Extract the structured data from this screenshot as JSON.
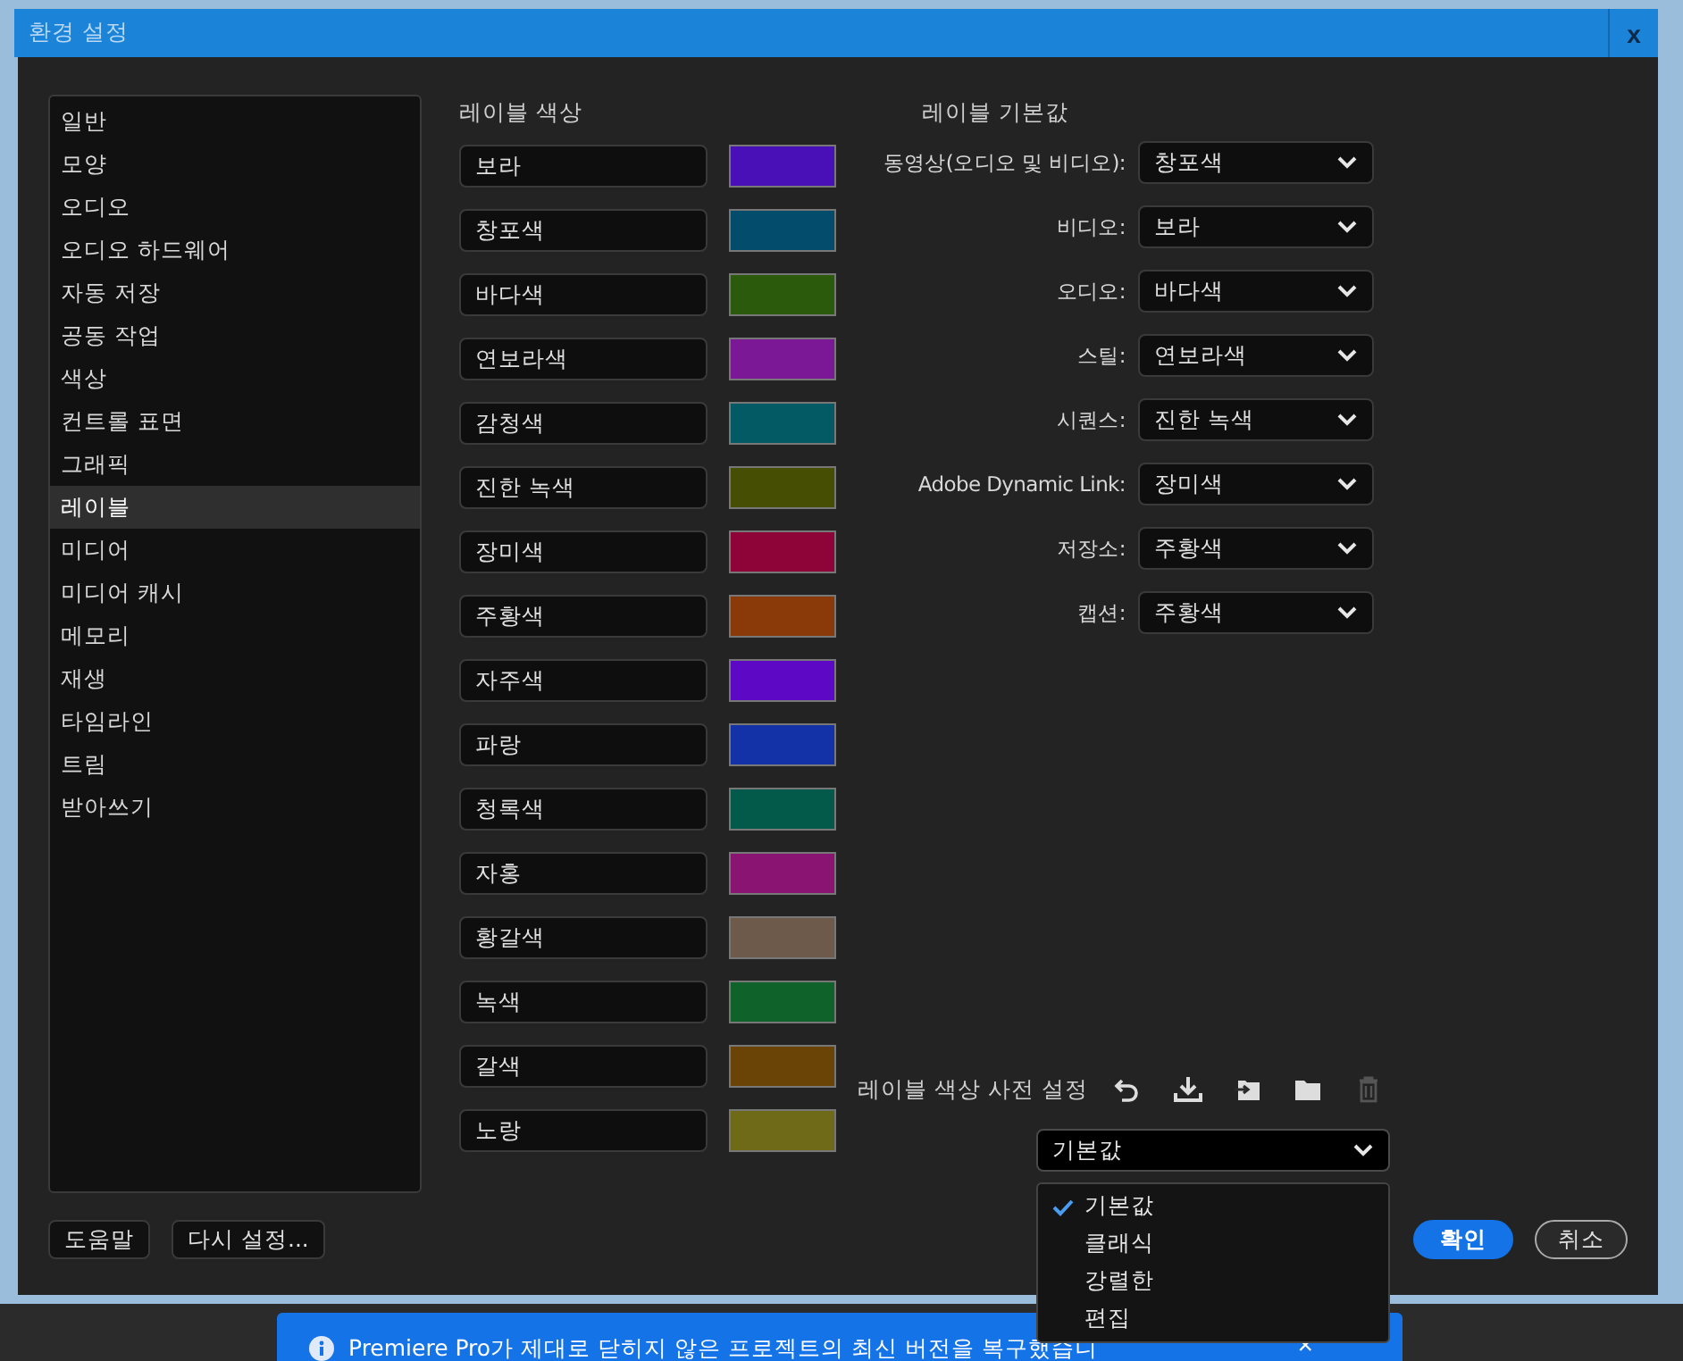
{
  "window": {
    "title": "환경 설정",
    "close": "x"
  },
  "sidebar": {
    "items": [
      {
        "label": "일반",
        "selected": false
      },
      {
        "label": "모양",
        "selected": false
      },
      {
        "label": "오디오",
        "selected": false
      },
      {
        "label": "오디오 하드웨어",
        "selected": false
      },
      {
        "label": "자동 저장",
        "selected": false
      },
      {
        "label": "공동 작업",
        "selected": false
      },
      {
        "label": "색상",
        "selected": false
      },
      {
        "label": "컨트롤 표면",
        "selected": false
      },
      {
        "label": "그래픽",
        "selected": false
      },
      {
        "label": "레이블",
        "selected": true
      },
      {
        "label": "미디어",
        "selected": false
      },
      {
        "label": "미디어 캐시",
        "selected": false
      },
      {
        "label": "메모리",
        "selected": false
      },
      {
        "label": "재생",
        "selected": false
      },
      {
        "label": "타임라인",
        "selected": false
      },
      {
        "label": "트림",
        "selected": false
      },
      {
        "label": "받아쓰기",
        "selected": false
      }
    ]
  },
  "label_colors": {
    "heading": "레이블 색상",
    "items": [
      {
        "name": "보라",
        "color": "#4a10b8"
      },
      {
        "name": "창포색",
        "color": "#034c6c"
      },
      {
        "name": "바다색",
        "color": "#2c5a0c"
      },
      {
        "name": "연보라색",
        "color": "#7a1896"
      },
      {
        "name": "감청색",
        "color": "#045a64"
      },
      {
        "name": "진한 녹색",
        "color": "#464e04"
      },
      {
        "name": "장미색",
        "color": "#8e0438"
      },
      {
        "name": "주황색",
        "color": "#8a3a08"
      },
      {
        "name": "자주색",
        "color": "#5c08c4"
      },
      {
        "name": "파랑",
        "color": "#1432a8"
      },
      {
        "name": "청록색",
        "color": "#045a4a"
      },
      {
        "name": "자홍",
        "color": "#8a1472"
      },
      {
        "name": "황갈색",
        "color": "#6e5a4a"
      },
      {
        "name": "녹색",
        "color": "#0e622a"
      },
      {
        "name": "갈색",
        "color": "#6a4406"
      },
      {
        "name": "노랑",
        "color": "#6e6a18"
      }
    ]
  },
  "label_defaults": {
    "heading": "레이블 기본값",
    "items": [
      {
        "label": "동영상(오디오 및 비디오):",
        "value": "창포색"
      },
      {
        "label": "비디오:",
        "value": "보라"
      },
      {
        "label": "오디오:",
        "value": "바다색"
      },
      {
        "label": "스틸:",
        "value": "연보라색"
      },
      {
        "label": "시퀀스:",
        "value": "진한 녹색"
      },
      {
        "label": "Adobe Dynamic Link:",
        "value": "장미색"
      },
      {
        "label": "저장소:",
        "value": "주황색"
      },
      {
        "label": "캡션:",
        "value": "주황색"
      }
    ]
  },
  "presets": {
    "label": "레이블 색상 사전 설정",
    "tools": [
      {
        "kind": "undo",
        "disabled": false
      },
      {
        "kind": "download",
        "disabled": false
      },
      {
        "kind": "import",
        "disabled": false
      },
      {
        "kind": "folder",
        "disabled": false
      },
      {
        "kind": "delete",
        "disabled": true
      }
    ],
    "value": "기본값",
    "menu": [
      {
        "label": "기본값",
        "selected": true
      },
      {
        "label": "클래식",
        "selected": false
      },
      {
        "label": "강렬한",
        "selected": false
      },
      {
        "label": "편집",
        "selected": false
      }
    ]
  },
  "footer_left": [
    {
      "label": "도움말"
    },
    {
      "label": "다시 설정..."
    }
  ],
  "footer_right": [
    {
      "label": "확인",
      "primary": true
    },
    {
      "label": "취소",
      "primary": false
    }
  ],
  "notification": {
    "text": "Premiere Pro가 제대로 닫히지 않은 프로젝트의 최신 버전을 복구했습니",
    "close": "×"
  }
}
